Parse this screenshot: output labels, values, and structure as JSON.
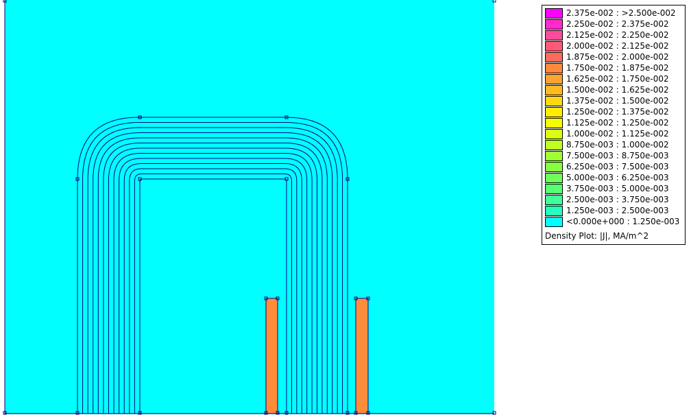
{
  "colors": {
    "background_field": "#00ffff",
    "contour_line": "#000080",
    "coil": "#ff8c3a",
    "node_marker": "#000080"
  },
  "legend": {
    "caption": "Density Plot: |J|, MA/m^2",
    "entries": [
      {
        "label": "2.375e-002 : >2.500e-002",
        "color": "#ff00ff"
      },
      {
        "label": "2.250e-002 : 2.375e-002",
        "color": "#ff2acc"
      },
      {
        "label": "2.125e-002 : 2.250e-002",
        "color": "#ff4a99"
      },
      {
        "label": "2.000e-002 : 2.125e-002",
        "color": "#ff5a74"
      },
      {
        "label": "1.875e-002 : 2.000e-002",
        "color": "#ff6a5a"
      },
      {
        "label": "1.750e-002 : 1.875e-002",
        "color": "#ff8a3e"
      },
      {
        "label": "1.625e-002 : 1.750e-002",
        "color": "#ffa230"
      },
      {
        "label": "1.500e-002 : 1.625e-002",
        "color": "#ffba20"
      },
      {
        "label": "1.375e-002 : 1.500e-002",
        "color": "#ffd810"
      },
      {
        "label": "1.250e-002 : 1.375e-002",
        "color": "#ffee00"
      },
      {
        "label": "1.125e-002 : 1.250e-002",
        "color": "#f4ff00"
      },
      {
        "label": "1.000e-002 : 1.125e-002",
        "color": "#d8ff10"
      },
      {
        "label": "8.750e-003 : 1.000e-002",
        "color": "#bcff20"
      },
      {
        "label": "7.500e-003 : 8.750e-003",
        "color": "#a0ff30"
      },
      {
        "label": "6.250e-003 : 7.500e-003",
        "color": "#86ff40"
      },
      {
        "label": "5.000e-003 : 6.250e-003",
        "color": "#6eff58"
      },
      {
        "label": "3.750e-003 : 5.000e-003",
        "color": "#56ff74"
      },
      {
        "label": "2.500e-003 : 3.750e-003",
        "color": "#3eff98"
      },
      {
        "label": "1.250e-003 : 2.500e-003",
        "color": "#24ffbe"
      },
      {
        "label": "<0.000e+000 : 1.250e-003",
        "color": "#00ffff"
      }
    ]
  }
}
